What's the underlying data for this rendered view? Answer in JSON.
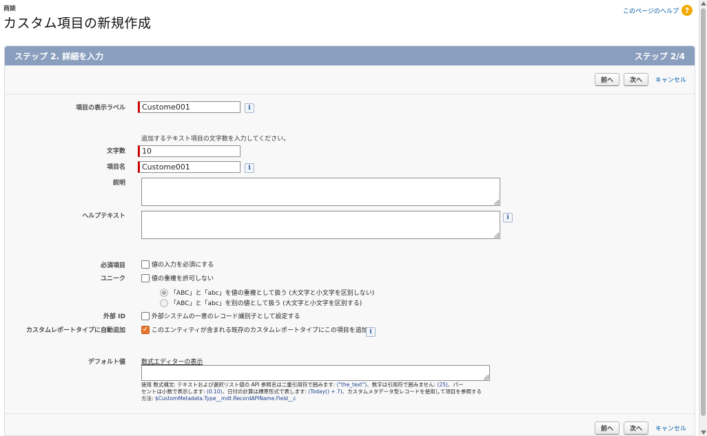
{
  "page": {
    "object_type": "商談",
    "title": "カスタム項目の新規作成",
    "help_link": "このページのヘルプ",
    "help_icon": "question-icon"
  },
  "step_bar": {
    "left": "ステップ 2. 詳細を入力",
    "right": "ステップ 2/4"
  },
  "buttons": {
    "prev": "前へ",
    "next": "次へ",
    "cancel": "キャンセル"
  },
  "form": {
    "label_field": {
      "label": "項目の表示ラベル",
      "value": "Custome001"
    },
    "length_hint": "追加するテキスト項目の文字数を入力してください。",
    "length_field": {
      "label": "文字数",
      "value": "10"
    },
    "name_field": {
      "label": "項目名",
      "value": "Custome001"
    },
    "description": {
      "label": "説明",
      "value": ""
    },
    "help_text": {
      "label": "ヘルプテキスト",
      "value": ""
    },
    "required": {
      "label": "必須項目",
      "option": "値の入力を必須にする",
      "checked": false
    },
    "unique": {
      "label": "ユニーク",
      "option": "値の重複を許可しない",
      "checked": false,
      "radio_1": "「ABC」と「abc」を値の重複として扱う (大文字と小文字を区別しない)",
      "radio_2": "「ABC」と「abc」を別の値として扱う (大文字と小文字を区別する)"
    },
    "external_id": {
      "label": "外部 ID",
      "option": "外部システムの一意のレコード識別子として設定する",
      "checked": false
    },
    "report_type": {
      "label": "カスタムレポートタイプに自動追加",
      "option": "このエンティティが含まれる既存のカスタムレポートタイプにこの項目を追加",
      "checked": true
    },
    "default_value": {
      "label": "デフォルト値",
      "formula_link": "数式エディターの表示",
      "value": "",
      "help_line_1_a": "使用 数式構文: テキストおよび選択リスト値の API 参照名は二重引用符で囲みます: ",
      "help_line_1_code_1": "(\"the_text\")",
      "help_line_1_b": "、数字は引用符で囲みません: ",
      "help_line_1_code_2": "(25)",
      "help_line_1_c": "、パー",
      "help_line_2_a": "セントは小数で表示します: ",
      "help_line_2_code_1": "(0.10)",
      "help_line_2_b": "、日付の計算は標準形式で表します: ",
      "help_line_2_code_2": "(Today() + 7)",
      "help_line_2_c": "、カスタムメタデータ型レコードを使用して項目を参照する",
      "help_line_3_a": "方法: ",
      "help_line_3_code": "$CustomMetadata.Type__mdt.RecordAPIName.Field__c"
    }
  },
  "colors": {
    "step_bar": "#8a9ebe",
    "required_marker": "#c00000",
    "link": "#015ba7",
    "checkbox_checked": "#e8772e"
  }
}
